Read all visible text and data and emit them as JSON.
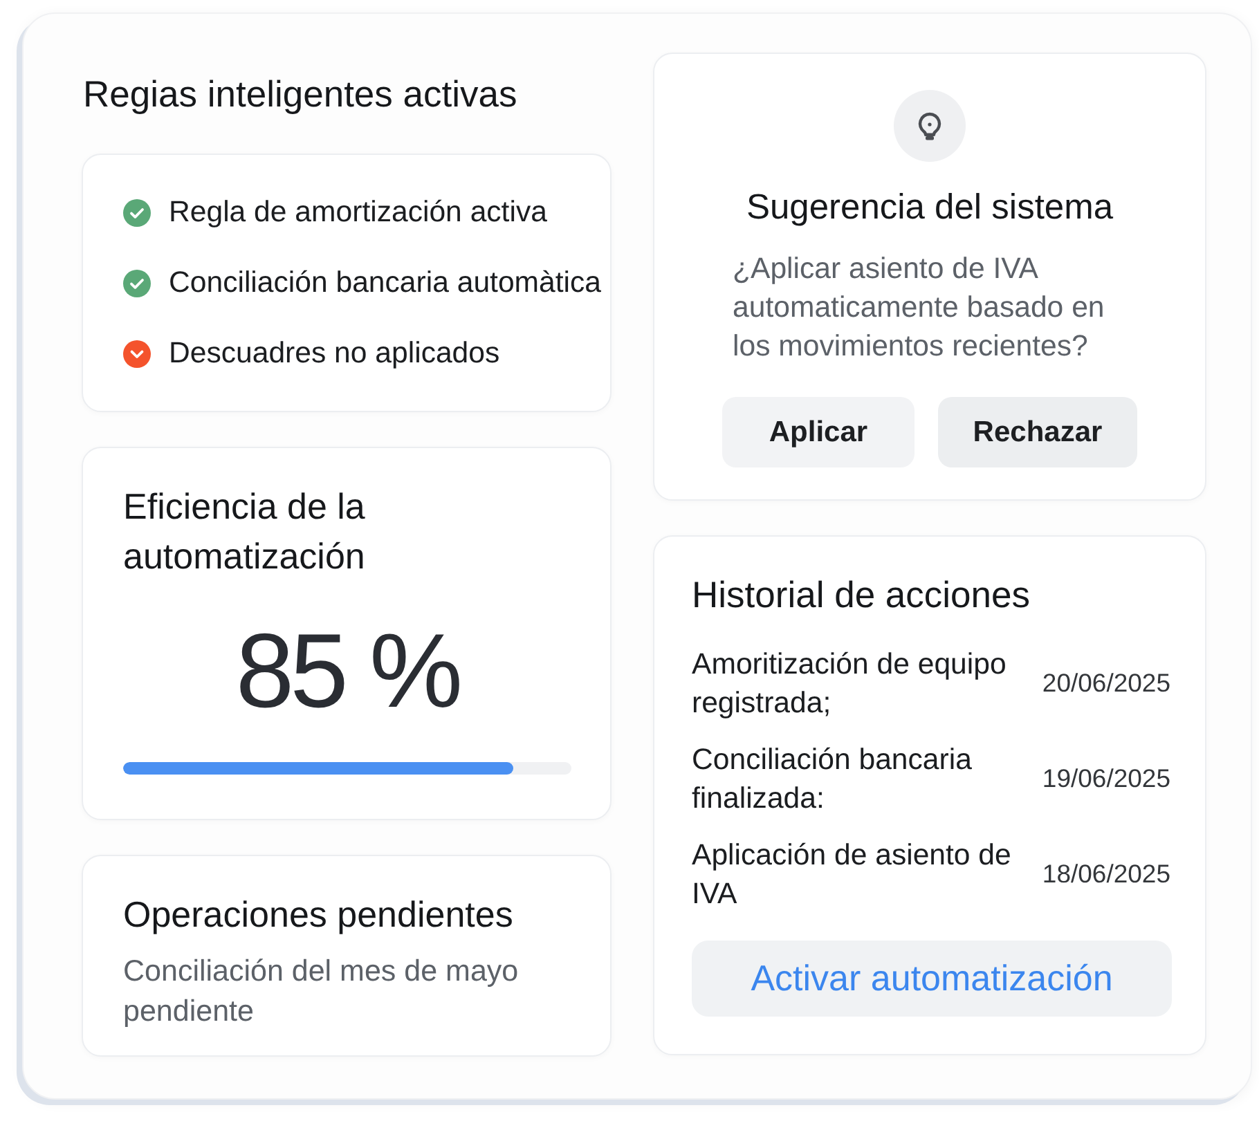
{
  "rules_panel": {
    "title": "Regias inteligentes activas",
    "rules": [
      {
        "label": "Regla de amortización activa",
        "kind": "ok",
        "color": "#5aa877"
      },
      {
        "label": "Conciliación bancaria automàtica",
        "kind": "ok",
        "color": "#5aa877"
      },
      {
        "label": "Descuadres no aplicados",
        "kind": "warning",
        "color": "#f4532c"
      }
    ]
  },
  "efficiency": {
    "title": "Eficiencia de la automatización",
    "value": "85 %",
    "level": 0.87
  },
  "pending": {
    "title": "Operaciones pendientes",
    "text": "Conciliación del mes de mayo pendiente"
  },
  "suggestion": {
    "title": "Sugerencia del sistema",
    "text": "¿Aplicar asiento de IVA automaticamente basado en los movimientos recientes?",
    "buttons": [
      {
        "label": "Aplicar"
      },
      {
        "label": "Rechazar"
      }
    ]
  },
  "history": {
    "title": "Historial de acciones",
    "entries": [
      {
        "text": "Amoritización de equipo registrada;",
        "date": "20/06/2025"
      },
      {
        "text": "Conciliación bancaria finalizada:",
        "date": "19/06/2025"
      },
      {
        "text": "Aplicación de asiento de IVA",
        "date": "18/06/2025"
      }
    ],
    "action": "Activar automatización"
  }
}
